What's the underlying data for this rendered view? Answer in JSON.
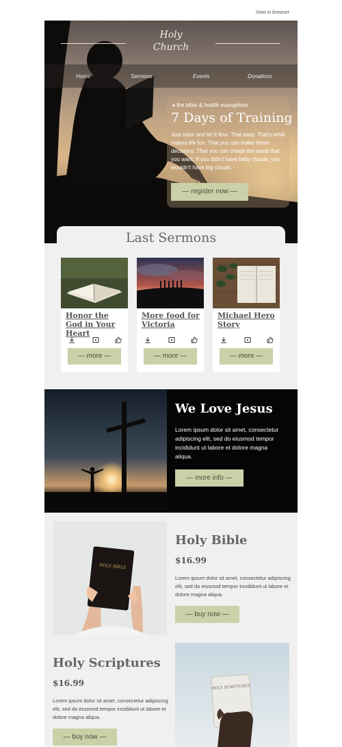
{
  "header": {
    "view_in_browser": "View in browser"
  },
  "logo": {
    "line1": "Holy",
    "line2": "Church"
  },
  "nav": {
    "items": [
      "Home",
      "Sermons",
      "Events",
      "Donations"
    ]
  },
  "hero": {
    "kicker": "♦ the bible & health evangelism",
    "title": "7 Days of Training",
    "text": "Just relax and let it flow. That easy. That's what makes life fun. That you can make these decisions. That you can create the world that you want. If you didn't have baby clouds, you wouldn't have big clouds.",
    "button": "— register now —"
  },
  "sermons": {
    "title": "Last Sermons",
    "cards": [
      {
        "title": "Honor the God in Your Heart",
        "button": "— more —"
      },
      {
        "title": "More food for Victoria",
        "button": "— more —"
      },
      {
        "title": "Michael Hero Story",
        "button": "— more —"
      }
    ]
  },
  "jesus": {
    "title": "We Love Jesus",
    "text": "Lorem ipsum dolor sit amet, consectetur adipiscing elit, sed do eiusmod tempor incididunt ut labore et dolore magna aliqua.",
    "button": "— more info —"
  },
  "products": [
    {
      "title": "Holy Bible",
      "price": "$16.99",
      "text": "Lorem ipsum dolor sit amet, consectetur adipiscing elit, sed do eiusmod tempor incididunt ut labore et dolore magna aliqua.",
      "button": "— buy now —",
      "book_label": "HOLY BIBLE"
    },
    {
      "title": "Holy Scriptures",
      "price": "$16.99",
      "text": "Lorem ipsum dolor sit amet, consectetur adipiscing elit, sed do eiusmod tempor incididunt ut labore et dolore magna aliqua.",
      "button": "— buy now —",
      "book_label": "HOLY SCRIPTURES"
    }
  ],
  "colors": {
    "accent": "#c9d1a8",
    "background": "#f0f0f0",
    "dark": "#040605"
  }
}
